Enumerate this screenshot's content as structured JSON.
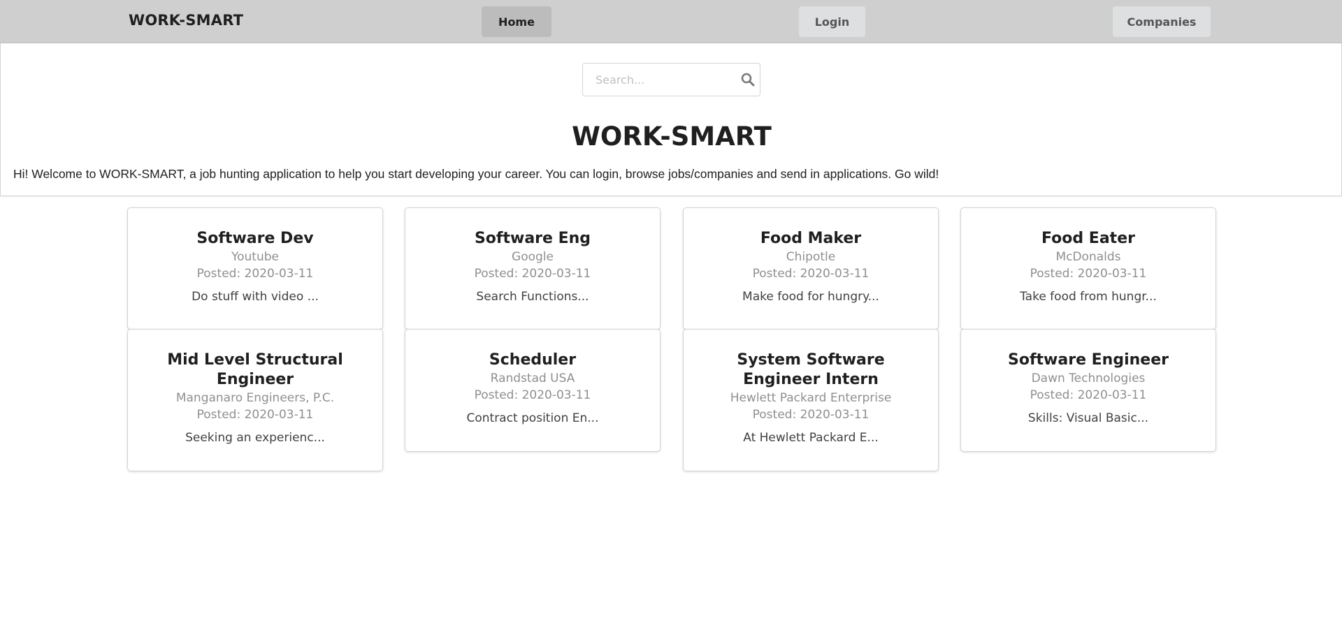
{
  "navbar": {
    "brand": "WORK-SMART",
    "home_label": "Home",
    "login_label": "Login",
    "companies_label": "Companies"
  },
  "search": {
    "placeholder": "Search...",
    "value": ""
  },
  "hero": {
    "title": "WORK-SMART",
    "text": "Hi! Welcome to WORK-SMART, a job hunting application to help you start developing your career. You can login, browse jobs/companies and send in applications. Go wild!"
  },
  "jobs": [
    {
      "title": "Software Dev",
      "company": "Youtube",
      "posted": "Posted: 2020-03-11",
      "description": "Do stuff with video ..."
    },
    {
      "title": "Software Eng",
      "company": "Google",
      "posted": "Posted: 2020-03-11",
      "description": "Search Functions..."
    },
    {
      "title": "Food Maker",
      "company": "Chipotle",
      "posted": "Posted: 2020-03-11",
      "description": "Make food for hungry..."
    },
    {
      "title": "Food Eater",
      "company": "McDonalds",
      "posted": "Posted: 2020-03-11",
      "description": "Take food from hungr..."
    },
    {
      "title": "Mid Level Structural Engineer",
      "company": "Manganaro Engineers, P.C.",
      "posted": "Posted: 2020-03-11",
      "description": "Seeking an experienc..."
    },
    {
      "title": "Scheduler",
      "company": "Randstad USA",
      "posted": "Posted: 2020-03-11",
      "description": "Contract position En..."
    },
    {
      "title": "System Software Engineer Intern",
      "company": "Hewlett Packard Enterprise",
      "posted": "Posted: 2020-03-11",
      "description": "At Hewlett Packard E..."
    },
    {
      "title": "Software Engineer",
      "company": "Dawn Technologies",
      "posted": "Posted: 2020-03-11",
      "description": "Skills: Visual Basic..."
    }
  ],
  "colors": {
    "navbar_bg": "#cfcfcf",
    "active_nav_bg": "#bcbcbc",
    "nav_button_bg": "#dedfe0",
    "meta_text": "#8f8f8f"
  },
  "icons": {
    "search": "search-icon"
  }
}
